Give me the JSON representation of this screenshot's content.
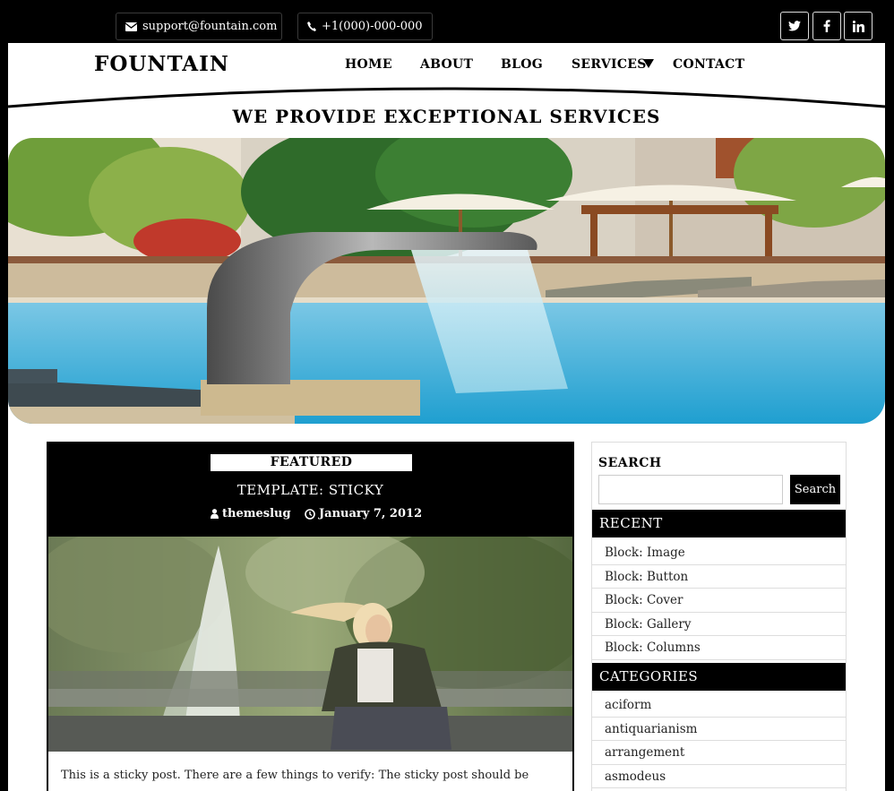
{
  "topbar": {
    "email": "support@fountain.com",
    "phone": "+1(000)-000-000",
    "social": [
      "twitter-icon",
      "facebook-icon",
      "linkedin-icon"
    ]
  },
  "header": {
    "logo": "FOUNTAIN",
    "nav": {
      "home": "HOME",
      "about": "ABOUT",
      "blog": "BLOG",
      "services": "SERVICES",
      "contact": "CONTACT"
    }
  },
  "hero": {
    "tagline": "WE PROVIDE EXCEPTIONAL SERVICES"
  },
  "post": {
    "badge": "FEATURED",
    "title": "TEMPLATE: STICKY",
    "author": "themeslug",
    "date": "January 7, 2012",
    "excerpt": "This is a sticky post. There are a few things to verify: The sticky post should be distinctly recognizable in some way in comparison to normal posts. You can style the"
  },
  "sidebar": {
    "search_label": "SEARCH",
    "search_button": "Search",
    "recent_title": "RECENT",
    "recent": [
      "Block: Image",
      "Block: Button",
      "Block: Cover",
      "Block: Gallery",
      "Block: Columns"
    ],
    "categories_title": "CATEGORIES",
    "categories": [
      "aciform",
      "antiquarianism",
      "arrangement",
      "asmodeus"
    ]
  },
  "colors": {
    "background": "#000000",
    "page": "#ffffff",
    "accent": "#000000"
  }
}
